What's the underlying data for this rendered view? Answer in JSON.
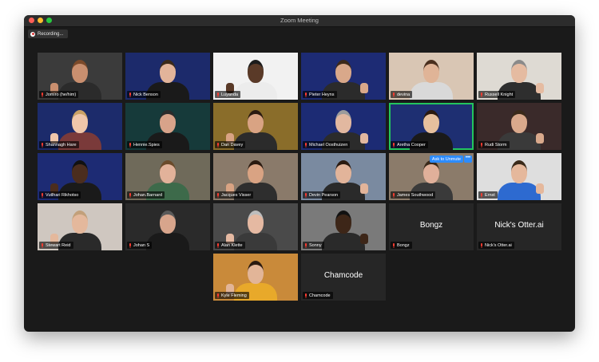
{
  "window": {
    "title": "Zoom Meeting"
  },
  "recording": {
    "label": "Recording..."
  },
  "controls": {
    "ask_to_unmute": "Ask to Unmute",
    "more": "•••"
  },
  "participants": [
    {
      "name": "Jomiro (he/him)",
      "bg": "#3b3b3b",
      "skin": "#c98f6f",
      "shirt": "#2b2b2b",
      "hair": "#7b4a2a"
    },
    {
      "name": "Nick Benson",
      "bg": "#1c2a6b",
      "skin": "#e2b49a",
      "shirt": "#1a1a1a",
      "hair": "#3a2a1a"
    },
    {
      "name": "Luyanda",
      "bg": "#f2f2f2",
      "skin": "#5a3a28",
      "shirt": "#ececec",
      "hair": "#1c1c1c"
    },
    {
      "name": "Pieter Heyns",
      "bg": "#1d2b74",
      "skin": "#d9a88a",
      "shirt": "#2b2b2b",
      "hair": "#3d2a1a"
    },
    {
      "name": "devina",
      "bg": "#d9c6b4",
      "skin": "#e0b497",
      "shirt": "#d9d9d9",
      "hair": "#4a2f1e"
    },
    {
      "name": "Russell Knight",
      "bg": "#dedad3",
      "skin": "#e5bba1",
      "shirt": "#2e2e2e",
      "hair": "#8a8a8a"
    },
    {
      "name": "Shannagh Hare",
      "bg": "#1c2b6b",
      "skin": "#efc6aa",
      "shirt": "#7a3a3a",
      "hair": "#c9a165"
    },
    {
      "name": "Hennie.Spies",
      "bg": "#163a3a",
      "skin": "#d8a38a",
      "shirt": "#1a1a1a",
      "hair": "#2b2b2b"
    },
    {
      "name": "Dan Davey",
      "bg": "#8a6d2a",
      "skin": "#d9a383",
      "shirt": "#2b2b2b",
      "hair": "#2a1a10"
    },
    {
      "name": "Michael Oosthuizen",
      "bg": "#1c2b74",
      "skin": "#e2b8a0",
      "shirt": "#2b2b2b",
      "hair": "#9c9c9c"
    },
    {
      "name": "Aretha Cooper",
      "bg": "#1e2f72",
      "skin": "#e6c09e",
      "shirt": "#1a1a1a",
      "hair": "#2b1a10"
    },
    {
      "name": "Rudi Storm",
      "bg": "#3a2a2a",
      "skin": "#d9a98c",
      "shirt": "#3a3a3a",
      "hair": "#3a2a1a"
    },
    {
      "name": "Vutlhari Rikhotso",
      "bg": "#1d2b74",
      "skin": "#4b2d1e",
      "shirt": "#1a1a1a",
      "hair": "#111111"
    },
    {
      "name": "Johan.Barnard",
      "bg": "#6f6a5a",
      "skin": "#e2b29a",
      "shirt": "#3d6a4a",
      "hair": "#6a4a2a"
    },
    {
      "name": "Jacques Visser",
      "bg": "#8a7a6a",
      "skin": "#d9a383",
      "shirt": "#2e2e2e",
      "hair": "#2a1a10"
    },
    {
      "name": "Devin Pearson",
      "bg": "#7a8aa0",
      "skin": "#e2b49a",
      "shirt": "#2a2a2a",
      "hair": "#2a1a10"
    },
    {
      "name": "James Southwood",
      "bg": "#8b7b6a",
      "skin": "#e0b09a",
      "shirt": "#3a3a3a",
      "hair": "#3a2a1a"
    },
    {
      "name": "Ernst",
      "bg": "#dedede",
      "skin": "#e5b89c",
      "shirt": "#2d6ad0",
      "hair": "#3a2a1a"
    },
    {
      "name": "Stewart Reid",
      "bg": "#cfc7c0",
      "skin": "#e4b89c",
      "shirt": "#2a2a2a",
      "hair": "#c2a07a"
    },
    {
      "name": "Johan S",
      "bg": "#2a2a2a",
      "skin": "#d8a58c",
      "shirt": "#1a1a1a",
      "hair": "#5a5a5a"
    },
    {
      "name": "Alan Klette",
      "bg": "#4a4a4a",
      "skin": "#e5b9a2",
      "shirt": "#3a3a3a",
      "hair": "#bdbdbd"
    },
    {
      "name": "Sonny",
      "bg": "#7a7a7a",
      "skin": "#3d2618",
      "shirt": "#2a2a2a",
      "hair": "#111111"
    },
    {
      "name": "Bongz",
      "text_only": true
    },
    {
      "name": "Nick's Otter.ai",
      "text_only": true
    },
    {
      "name": "Kyle Fleming",
      "bg": "#c98a3a",
      "skin": "#e2b598",
      "shirt": "#e8a92a",
      "hair": "#2a1a10"
    },
    {
      "name": "Chamcode",
      "text_only": true
    }
  ]
}
